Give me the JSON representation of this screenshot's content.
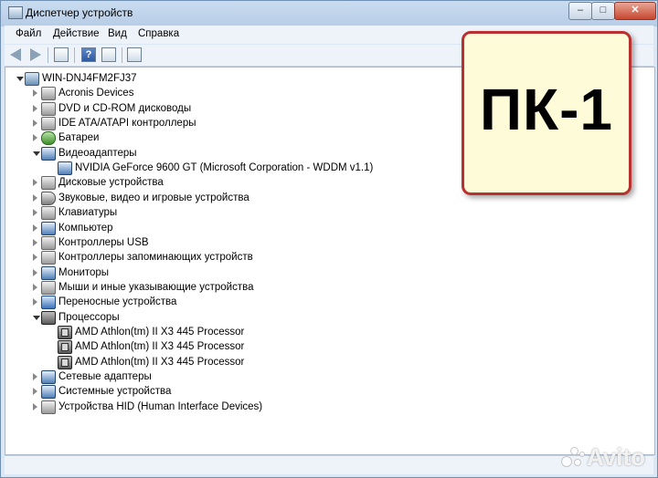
{
  "window": {
    "title": "Диспетчер устройств",
    "controls": {
      "minimize": "–",
      "maximize": "□",
      "close": "✕"
    }
  },
  "menu": [
    "Файл",
    "Действие",
    "Вид",
    "Справка"
  ],
  "toolbar": {
    "icons": [
      "back-icon",
      "forward-icon",
      "properties-icon",
      "help-icon",
      "console-tree-icon",
      "scan-hardware-icon"
    ],
    "help_glyph": "?"
  },
  "tree": {
    "root": "WIN-DNJ4FM2FJ37",
    "items": [
      {
        "label": "Acronis Devices",
        "icon": "grey"
      },
      {
        "label": "DVD и CD-ROM дисководы",
        "icon": "grey"
      },
      {
        "label": "IDE ATA/ATAPI контроллеры",
        "icon": "grey"
      },
      {
        "label": "Батареи",
        "icon": "green"
      },
      {
        "label": "Видеоадаптеры",
        "icon": "monitor",
        "expanded": true,
        "children": [
          "NVIDIA GeForce 9600 GT (Microsoft Corporation - WDDM v1.1)"
        ]
      },
      {
        "label": "Дисковые устройства",
        "icon": "grey"
      },
      {
        "label": "Звуковые, видео и игровые устройства",
        "icon": "speaker"
      },
      {
        "label": "Клавиатуры",
        "icon": "grey"
      },
      {
        "label": "Компьютер",
        "icon": "monitor"
      },
      {
        "label": "Контроллеры USB",
        "icon": "grey"
      },
      {
        "label": "Контроллеры запоминающих устройств",
        "icon": "grey"
      },
      {
        "label": "Мониторы",
        "icon": "monitor"
      },
      {
        "label": "Мыши и иные указывающие устройства",
        "icon": "grey"
      },
      {
        "label": "Переносные устройства",
        "icon": "blue"
      },
      {
        "label": "Процессоры",
        "icon": "chip",
        "expanded": true,
        "children": [
          "AMD Athlon(tm) II X3 445 Processor",
          "AMD Athlon(tm) II X3 445 Processor",
          "AMD Athlon(tm) II X3 445 Processor"
        ]
      },
      {
        "label": "Сетевые адаптеры",
        "icon": "monitor"
      },
      {
        "label": "Системные устройства",
        "icon": "monitor"
      },
      {
        "label": "Устройства HID (Human Interface Devices)",
        "icon": "grey"
      }
    ]
  },
  "badge": {
    "text": "ПК-1",
    "background": "#fefbd8",
    "border": "#b93030"
  },
  "watermark": {
    "text": "Avito"
  }
}
